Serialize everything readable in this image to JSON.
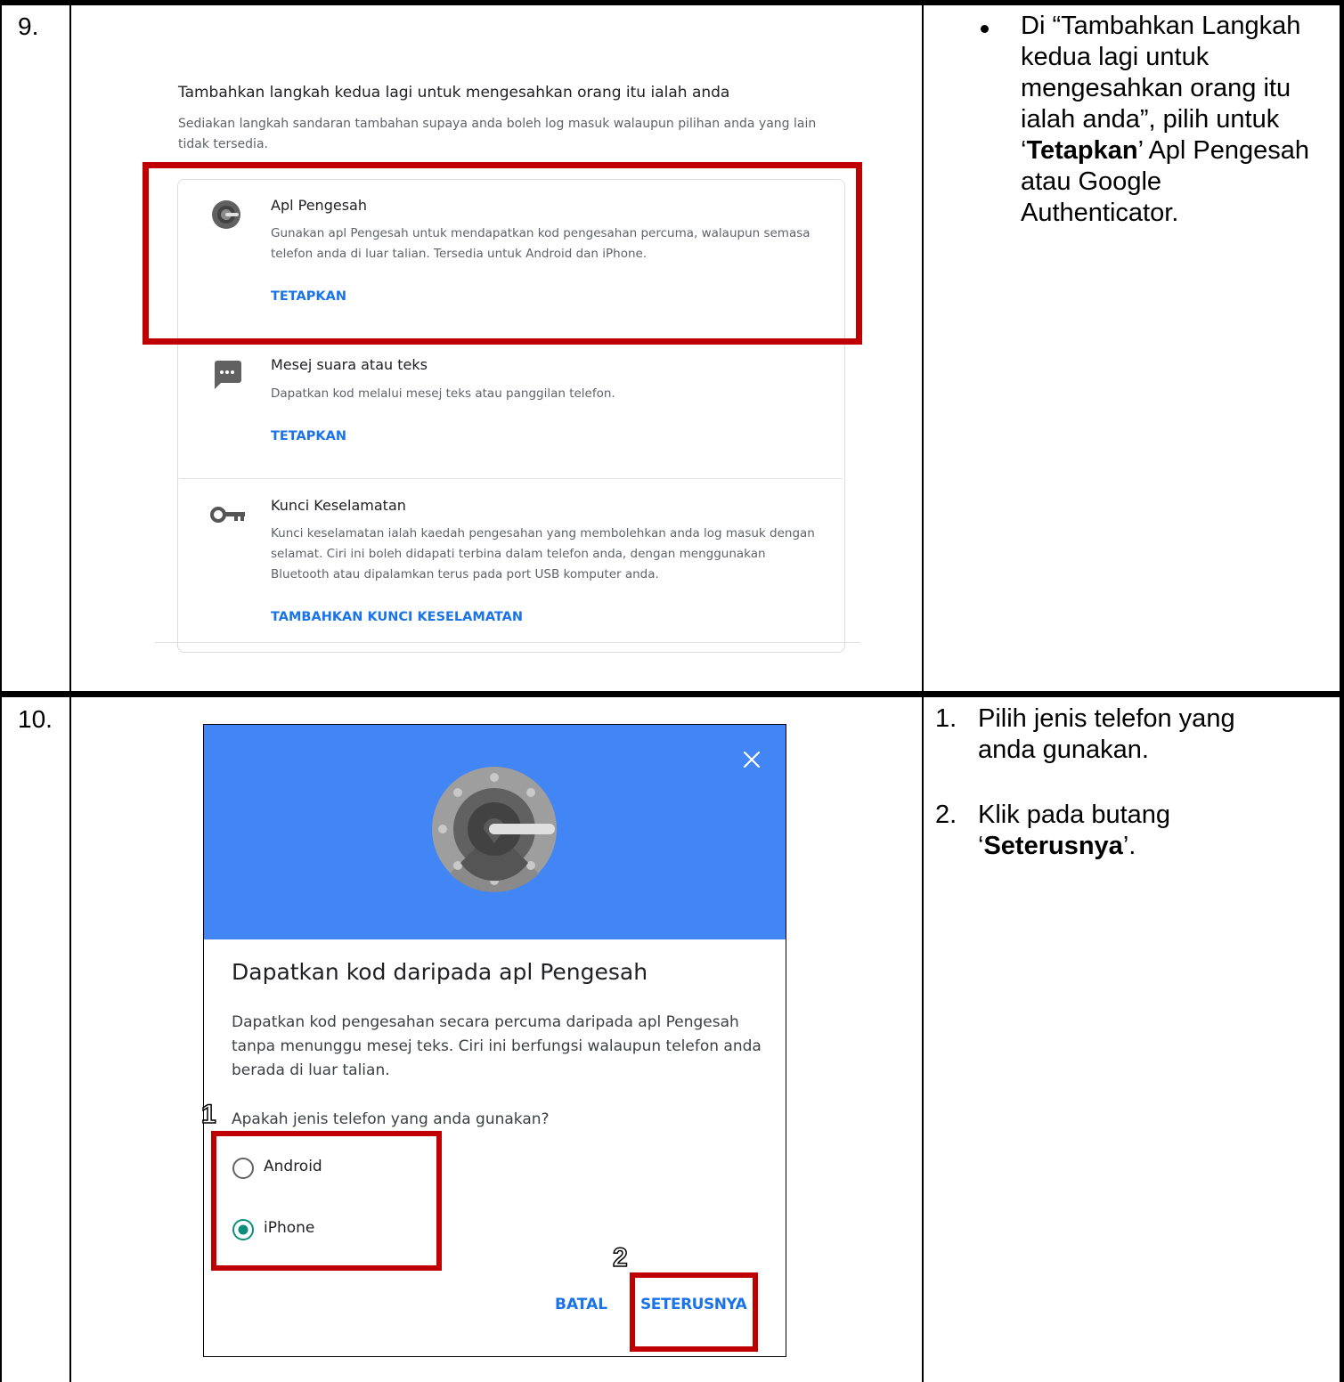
{
  "rows": [
    {
      "number": "9.",
      "section": {
        "heading": "Tambahkan langkah kedua lagi untuk mengesahkan orang itu ialah anda",
        "description": "Sediakan langkah sandaran tambahan supaya anda boleh log masuk walaupun pilihan anda yang lain tidak tersedia.",
        "options": [
          {
            "icon": "authenticator-icon",
            "title": "Apl Pengesah",
            "description": "Gunakan apl Pengesah untuk mendapatkan kod pengesahan percuma, walaupun semasa telefon anda di luar talian. Tersedia untuk Android dan iPhone.",
            "action": "TETAPKAN"
          },
          {
            "icon": "message-icon",
            "title": "Mesej suara atau teks",
            "description": "Dapatkan kod melalui mesej teks atau panggilan telefon.",
            "action": "TETAPKAN"
          },
          {
            "icon": "key-icon",
            "title": "Kunci Keselamatan",
            "description": "Kunci keselamatan ialah kaedah pengesahan yang membolehkan anda log masuk dengan selamat. Ciri ini boleh didapati terbina dalam telefon anda, dengan menggunakan Bluetooth atau dipalamkan terus pada port USB komputer anda.",
            "action": "TAMBAHKAN KUNCI KESELAMATAN"
          }
        ]
      },
      "instruction": {
        "pre": "Di “Tambahkan Langkah kedua lagi untuk mengesahkan orang itu ialah anda”, pilih untuk ‘",
        "bold": "Tetapkan",
        "post": "’ Apl Pengesah atau Google Authenticator."
      }
    },
    {
      "number": "10.",
      "dialog": {
        "close_icon": "close-icon",
        "title": "Dapatkan kod daripada apl Pengesah",
        "description": "Dapatkan kod pengesahan secara percuma daripada apl Pengesah tanpa menunggu mesej teks. Ciri ini berfungsi walaupun telefon anda berada di luar talian.",
        "question": "Apakah jenis telefon yang anda gunakan?",
        "options": [
          {
            "label": "Android",
            "selected": false
          },
          {
            "label": "iPhone",
            "selected": true
          }
        ],
        "cancel_label": "BATAL",
        "next_label": "SETERUSNYA",
        "marker_1": "1",
        "marker_2": "2",
        "header_color": "#4285f4"
      },
      "steps": [
        {
          "num": "1.",
          "text": "Pilih jenis telefon yang anda gunakan."
        },
        {
          "num": "2.",
          "pre": "Klik pada butang ‘",
          "bold": "Seterusnya",
          "post": "’."
        }
      ]
    }
  ],
  "colors": {
    "highlight": "#c00000",
    "link": "#1a73e8",
    "radio": "#0b8f7c"
  }
}
